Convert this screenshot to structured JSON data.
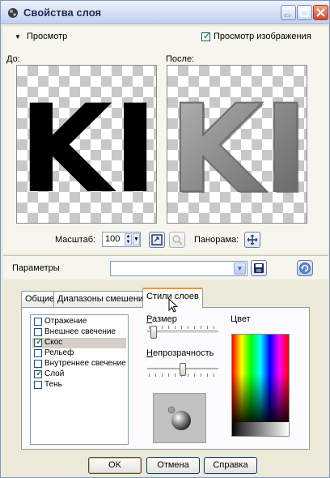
{
  "window": {
    "title": "Свойства слоя",
    "controls": [
      "minimize",
      "maximize",
      "close"
    ]
  },
  "preview_section": {
    "toggle_label": "Просмотр",
    "show_preview_label": "Просмотр изображения",
    "show_preview_checked": true,
    "before_label": "До:",
    "after_label": "После:",
    "preview_glyph": "KI",
    "zoom_label": "Масштаб:",
    "zoom_value": "100",
    "pan_label": "Панорама:",
    "pan_icon": "move-arrows-icon",
    "fit_icon": "fit-to-window-icon",
    "zoom_icon": "zoom-magnifier-icon"
  },
  "params": {
    "label": "Параметры",
    "preset_value": "",
    "save_icon": "floppy-disk-icon",
    "reset_icon": "reset-arrow-icon"
  },
  "tabs": [
    {
      "label": "Общие",
      "active": false
    },
    {
      "label": "Диапазоны смешения",
      "active": false
    },
    {
      "label": "Стили слоев",
      "active": true
    }
  ],
  "layer_styles": [
    {
      "label": "Отражение",
      "checked": false,
      "selected": false
    },
    {
      "label": "Внешнее свечение",
      "checked": false,
      "selected": false
    },
    {
      "label": "Скос",
      "checked": true,
      "selected": true
    },
    {
      "label": "Рельеф",
      "checked": false,
      "selected": false
    },
    {
      "label": "Внутреннее свечение",
      "checked": false,
      "selected": false
    },
    {
      "label": "Слой",
      "checked": true,
      "selected": false
    },
    {
      "label": "Тень",
      "checked": false,
      "selected": false
    }
  ],
  "style_settings": {
    "size_label": "Размер",
    "size_level": 0.05,
    "opacity_label": "Непрозрачность",
    "opacity_level": 0.5,
    "color_label": "Цвет",
    "light_preview_icon": "sphere-light-icon"
  },
  "buttons": {
    "ok": "OK",
    "cancel": "Отмена",
    "help": "Справка"
  },
  "colors": {
    "accent_tab": "#e69b2a",
    "window_bg": "#ece9d8",
    "selection": "#d4d0c8"
  }
}
